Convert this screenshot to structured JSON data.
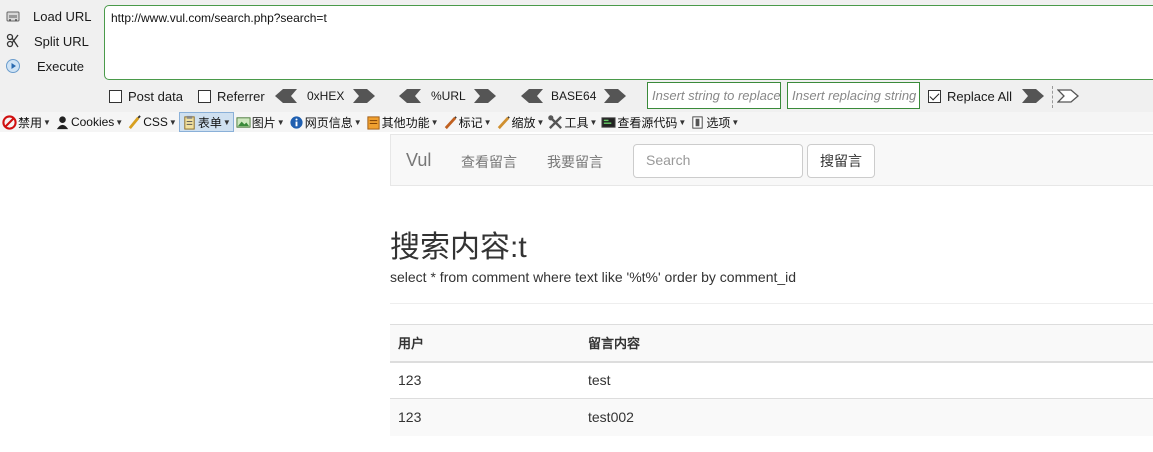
{
  "hackbar": {
    "commands": [
      {
        "label": "Load URL",
        "icon": "load-url-icon"
      },
      {
        "label": "Split URL",
        "icon": "split-url-icon"
      },
      {
        "label": "Execute",
        "icon": "execute-icon"
      }
    ],
    "url_value": "http://www.vul.com/search.php?search=t",
    "post_data_label": "Post data",
    "post_data_checked": false,
    "referrer_label": "Referrer",
    "referrer_checked": false,
    "encoders": [
      "0xHEX",
      "%URL",
      "BASE64"
    ],
    "insert_string_placeholder": "Insert string to replace",
    "insert_replacing_placeholder": "Insert replacing string",
    "replace_all_label": "Replace All",
    "replace_all_checked": true,
    "border_color": "#4a9a4a"
  },
  "devbar": {
    "items": [
      {
        "label": "禁用",
        "icon": "disable-icon"
      },
      {
        "label": "Cookies",
        "icon": "cookies-icon"
      },
      {
        "label": "CSS",
        "icon": "css-icon"
      },
      {
        "label": "表单",
        "icon": "forms-icon",
        "active": true
      },
      {
        "label": "图片",
        "icon": "images-icon"
      },
      {
        "label": "网页信息",
        "icon": "info-icon"
      },
      {
        "label": "其他功能",
        "icon": "misc-icon"
      },
      {
        "label": "标记",
        "icon": "outline-icon"
      },
      {
        "label": "缩放",
        "icon": "resize-icon"
      },
      {
        "label": "工具",
        "icon": "tools-icon"
      },
      {
        "label": "查看源代码",
        "icon": "view-source-icon"
      },
      {
        "label": "选项",
        "icon": "options-icon"
      }
    ]
  },
  "navbar": {
    "brand": "Vul",
    "links": [
      "查看留言",
      "我要留言"
    ],
    "search_placeholder": "Search",
    "search_button": "搜留言"
  },
  "main": {
    "title": "搜索内容:t",
    "sql": "select * from comment where text like '%t%' order by comment_id",
    "table": {
      "headers": [
        "用户",
        "留言内容"
      ],
      "rows": [
        [
          "123",
          "test"
        ],
        [
          "123",
          "test002"
        ]
      ]
    }
  }
}
